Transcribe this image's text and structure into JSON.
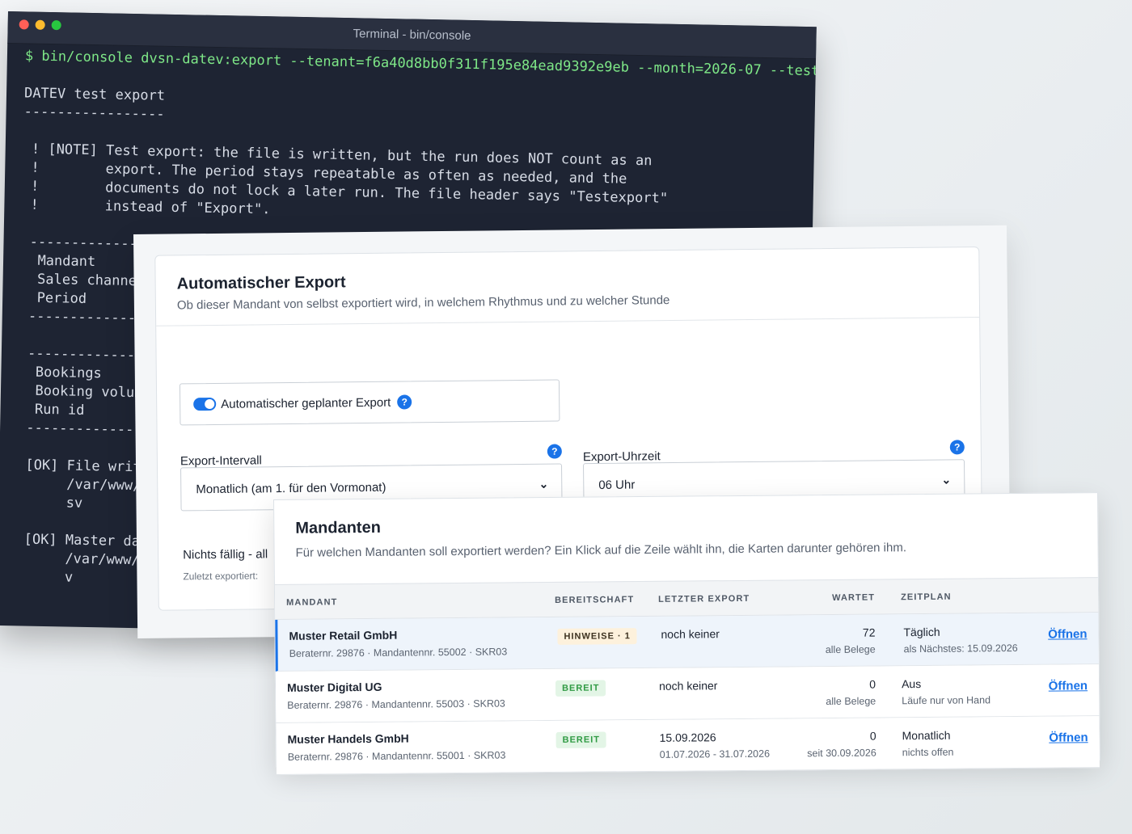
{
  "terminal": {
    "title": "Terminal - bin/console",
    "lines": [
      "$ bin/console dvsn-datev:export --tenant=f6a40d8bb0f311f195e84ead9392e9eb --month=2026-07 --test",
      "",
      "DATEV test export",
      "-----------------",
      "",
      " ! [NOTE] Test export: the file is written, but the run does NOT count as an",
      " !        export. The period stays repeatable as often as needed, and the",
      " !        documents do not lock a later run. The file header says \"Testexport\"",
      " !        instead of \"Export\".",
      "",
      " ---------------",
      "  Mandant",
      "  Sales channel",
      "  Period",
      " ---------------",
      "",
      " ---------------",
      "  Bookings",
      "  Booking volum",
      "  Run id",
      " ---------------",
      "",
      " [OK] File writ",
      "      /var/www/h",
      "      sv",
      "",
      " [OK] Master dat",
      "      /var/www/h",
      "      v"
    ]
  },
  "export": {
    "title": "Automatischer Export",
    "subtitle": "Ob dieser Mandant von selbst exportiert wird, in welchem Rhythmus und zu welcher Stunde",
    "toggle_label": "Automatischer geplanter Export",
    "help_glyph": "?",
    "interval_label": "Export-Intervall",
    "interval_value": "Monatlich (am 1. für den Vormonat)",
    "time_label": "Export-Uhrzeit",
    "time_value": "06 Uhr",
    "nichts": "Nichts fällig - all",
    "zuletzt": "Zuletzt exportiert:",
    "accent": "#1a73e8"
  },
  "mandanten": {
    "title": "Mandanten",
    "subtitle": "Für welchen Mandanten soll exportiert werden? Ein Klick auf die Zeile wählt ihn, die Karten darunter gehören ihm.",
    "columns": {
      "mandant": "MANDANT",
      "bereitschaft": "BEREITSCHAFT",
      "letzter_export": "LETZTER EXPORT",
      "wartet": "WARTET",
      "zeitplan": "ZEITPLAN"
    },
    "rows": [
      {
        "name": "Muster Retail GmbH",
        "meta": "Beraternr. 29876 · Mandantennr. 55002 · SKR03",
        "badge": "HINWEISE · 1",
        "last": "noch keiner",
        "last_sub": "",
        "wait": "72",
        "wait_sub": "alle Belege",
        "plan": "Täglich",
        "plan_sub": "als Nächstes: 15.09.2026",
        "open": "Öffnen"
      },
      {
        "name": "Muster Digital UG",
        "meta": "Beraternr. 29876 · Mandantennr. 55003 · SKR03",
        "badge": "BEREIT",
        "last": "noch keiner",
        "last_sub": "",
        "wait": "0",
        "wait_sub": "alle Belege",
        "plan": "Aus",
        "plan_sub": "Läufe nur von Hand",
        "open": "Öffnen"
      },
      {
        "name": "Muster Handels GmbH",
        "meta": "Beraternr. 29876 · Mandantennr. 55001 · SKR03",
        "badge": "BEREIT",
        "last": "15.09.2026",
        "last_sub": "01.07.2026 - 31.07.2026",
        "wait": "0",
        "wait_sub": "seit 30.09.2026",
        "plan": "Monatlich",
        "plan_sub": "nichts offen",
        "open": "Öffnen"
      }
    ]
  }
}
